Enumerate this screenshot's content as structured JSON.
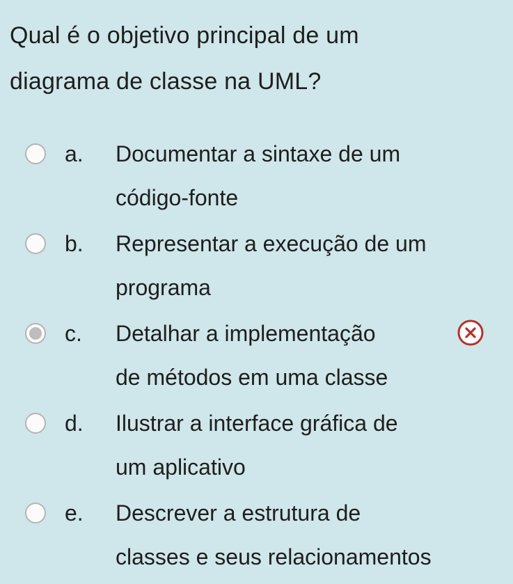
{
  "question": {
    "text": "Qual é o objetivo principal de um\ndiagrama de classe na UML?"
  },
  "options": [
    {
      "letter": "a.",
      "text": "Documentar a sintaxe de um\ncódigo-fonte"
    },
    {
      "letter": "b.",
      "text": "Representar a execução de um\nprograma"
    },
    {
      "letter": "c.",
      "text": "Detalhar a implementação\nde métodos em uma classe"
    },
    {
      "letter": "d.",
      "text": "Ilustrar a interface gráfica de\num aplicativo"
    },
    {
      "letter": "e.",
      "text": "Descrever a estrutura de\nclasses e seus relacionamentos"
    }
  ],
  "state": {
    "selected_option": "c",
    "feedback": "incorrect",
    "feedback_icon": "close-circle-icon",
    "feedback_color": "#b3322b"
  }
}
